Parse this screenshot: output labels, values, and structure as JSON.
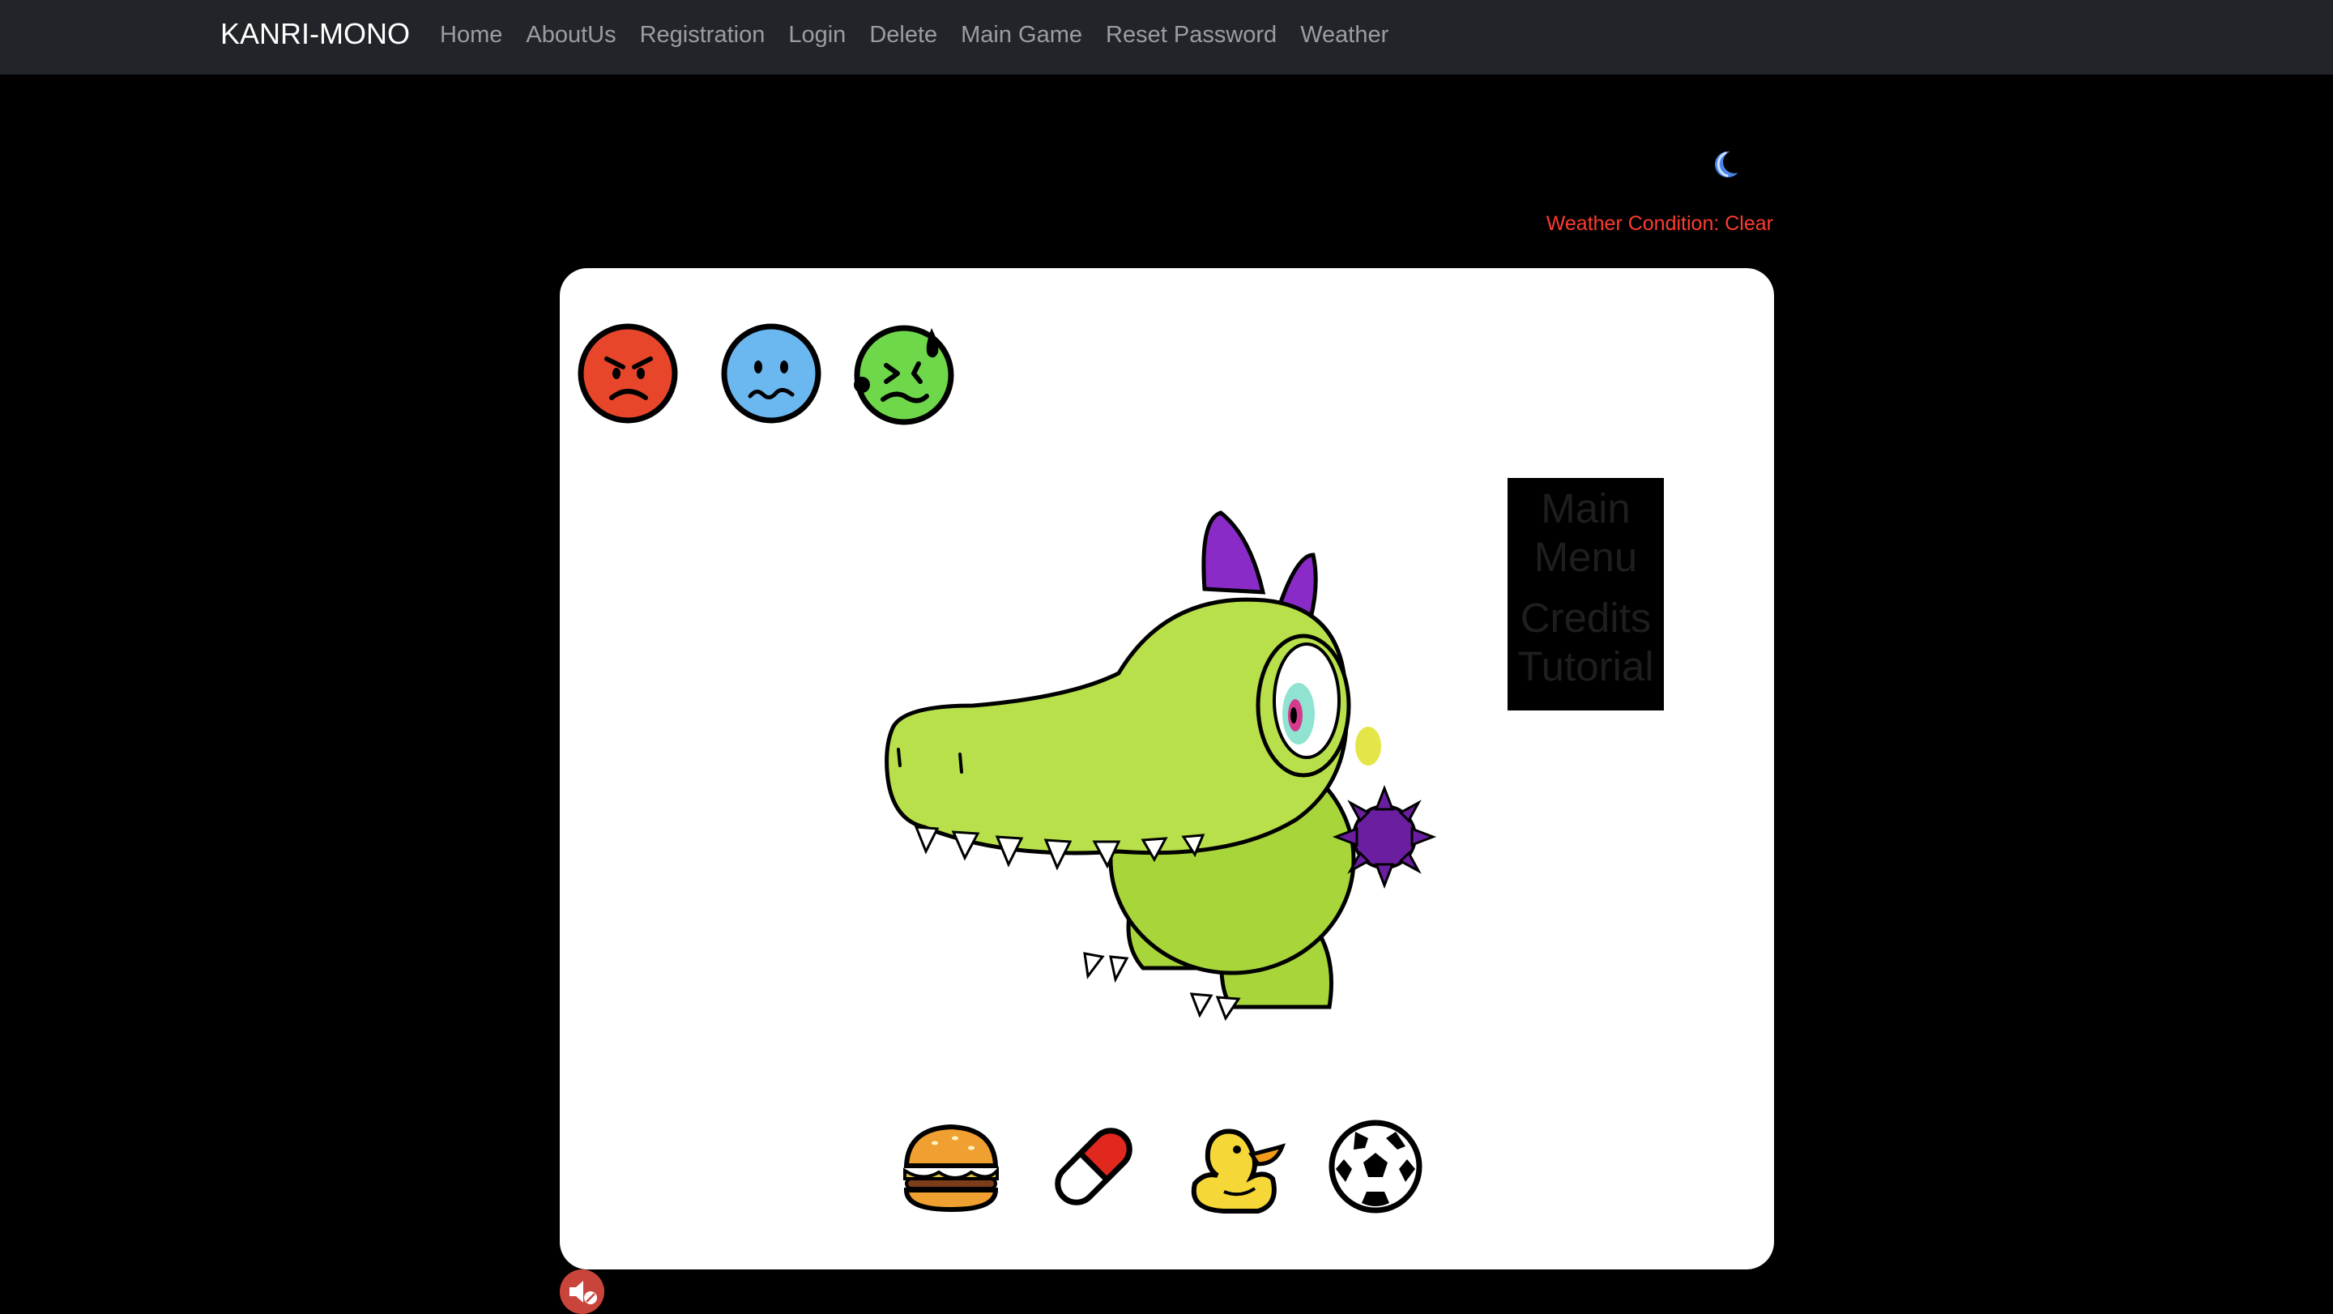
{
  "navbar": {
    "brand": "KANRI-MONO",
    "links": [
      "Home",
      "AboutUs",
      "Registration",
      "Login",
      "Delete",
      "Main Game",
      "Reset Password",
      "Weather"
    ]
  },
  "weather": {
    "icon": "crescent-moon-icon",
    "condition_text": "Weather Condition: Clear"
  },
  "game": {
    "mood_icons": [
      "angry-face-icon",
      "sad-face-icon",
      "sick-face-icon"
    ],
    "pet": "green-crocodile-monster",
    "menu": {
      "main": "Main Menu",
      "credits": "Credits",
      "tutorial": "Tutorial"
    },
    "items": [
      "burger-icon",
      "pill-icon",
      "rubber-duck-icon",
      "soccer-ball-icon"
    ]
  },
  "sound": {
    "icon": "mute-icon"
  },
  "colors": {
    "navbar_bg": "#212529",
    "page_bg": "#000000",
    "card_bg": "#ffffff",
    "weather_text": "#ff3b30",
    "angry": "#e8462a",
    "sad": "#6bb7f0",
    "sick": "#6fd84a",
    "pet_body": "#a8d63a",
    "pet_horns": "#8a2bc7"
  }
}
